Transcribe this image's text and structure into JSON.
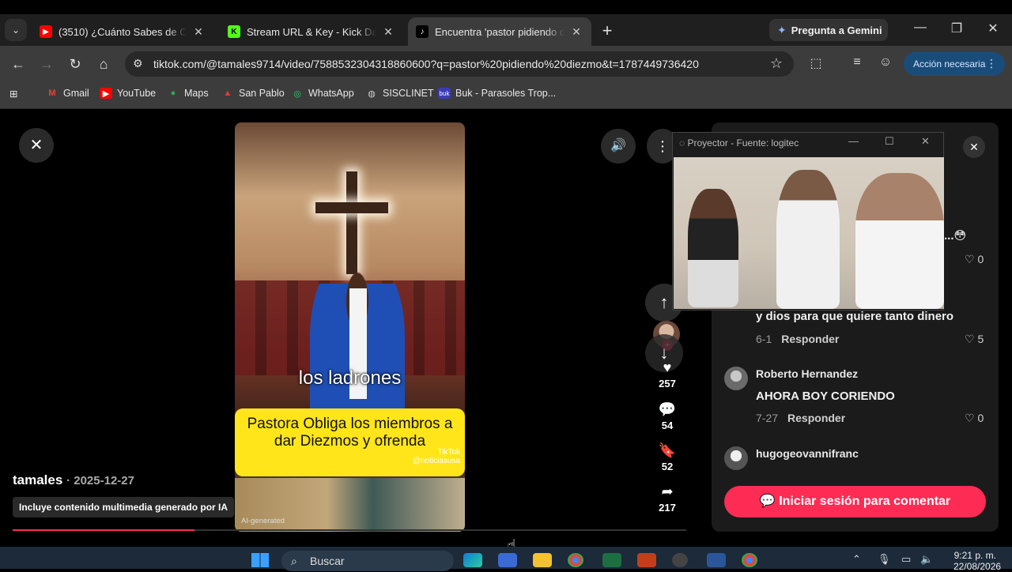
{
  "browser": {
    "tabs": [
      {
        "title": "(3510) ¿Cuánto Sabes de CULTURA",
        "icon": "youtube-icon"
      },
      {
        "title": "Stream URL & Key - Kick Dashboard",
        "icon": "kick-icon"
      },
      {
        "title": "Encuentra 'pastor pidiendo diezmo'",
        "icon": "tiktok-icon"
      }
    ],
    "gemini_label": "Pregunta a Gemini",
    "url": "tiktok.com/@tamales9714/video/7588532304318860600?q=pastor%20pidiendo%20diezmo&t=1787449736420",
    "action_label": "Acción necesaria",
    "bookmarks": [
      "Gmail",
      "YouTube",
      "Maps",
      "San Pablo",
      "WhatsApp",
      "SISCLINET",
      "Buk - Parasoles Trop..."
    ]
  },
  "video": {
    "overlay_text": "los ladrones",
    "caption": "Pastora Obliga los miembros a dar Diezmos y ofrenda",
    "watermark": "TikTok",
    "watermark_handle": "@noticiasusa",
    "ai_label": "AI-generated",
    "author": "tamales",
    "date": "2025-12-27",
    "ai_badge": "Incluye contenido multimedia generado por IA",
    "progress": 0.27
  },
  "stats": {
    "likes": "257",
    "comments": "54",
    "saves": "52",
    "shares": "217"
  },
  "comments_panel": {
    "items": [
      {
        "text": "...😳",
        "like_count": "0"
      },
      {
        "text": "y dios para que quiere tanto dinero",
        "date": "6-1",
        "reply": "Responder",
        "like_count": "5"
      },
      {
        "user": "Roberto Hernandez",
        "text": "AHORA BOY CORIENDO",
        "date": "7-27",
        "reply": "Responder",
        "like_count": "0"
      },
      {
        "user": "hugogeovannifranc"
      }
    ],
    "login_label": "Iniciar sesión para comentar"
  },
  "projector": {
    "title": "Proyector - Fuente: logitec"
  },
  "taskbar": {
    "search_label": "Buscar",
    "time": "9:21 p. m.",
    "date": "22/08/2026"
  }
}
